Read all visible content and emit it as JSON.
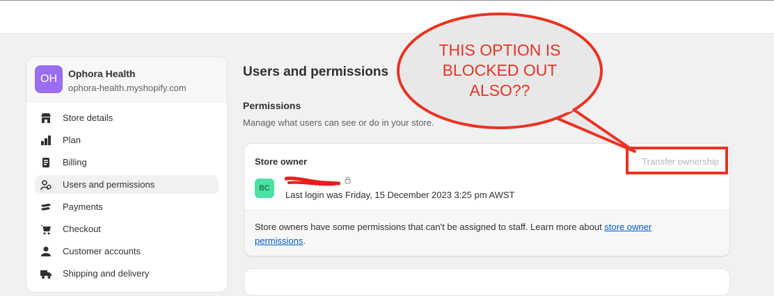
{
  "store": {
    "initials": "OH",
    "name": "Ophora Health",
    "url": "ophora-health.myshopify.com"
  },
  "sidebar": {
    "items": [
      {
        "label": "Store details",
        "icon": "store-icon"
      },
      {
        "label": "Plan",
        "icon": "plan-icon"
      },
      {
        "label": "Billing",
        "icon": "billing-icon"
      },
      {
        "label": "Users and permissions",
        "icon": "users-icon",
        "active": true
      },
      {
        "label": "Payments",
        "icon": "payments-icon"
      },
      {
        "label": "Checkout",
        "icon": "cart-icon"
      },
      {
        "label": "Customer accounts",
        "icon": "person-icon"
      },
      {
        "label": "Shipping and delivery",
        "icon": "truck-icon"
      }
    ]
  },
  "main": {
    "title": "Users and permissions",
    "permissions_title": "Permissions",
    "permissions_desc": "Manage what users can see or do in your store."
  },
  "owner_card": {
    "title": "Store owner",
    "transfer_label": "Transfer ownership",
    "owner_initials": "BC",
    "last_login": "Last login was Friday, 15 December 2023 3:25 pm AWST",
    "footer_text": "Store owners have some permissions that can't be assigned to staff. Learn more about ",
    "footer_link": "store owner permissions",
    "footer_end": "."
  },
  "annotation": {
    "bubble_text": "THIS OPTION IS BLOCKED OUT ALSO??",
    "color": "#ea3323"
  },
  "colors": {
    "avatar": "#9b6df0",
    "owner_avatar": "#4be1a0",
    "link": "#005bd3",
    "background": "#f1f1f1"
  }
}
